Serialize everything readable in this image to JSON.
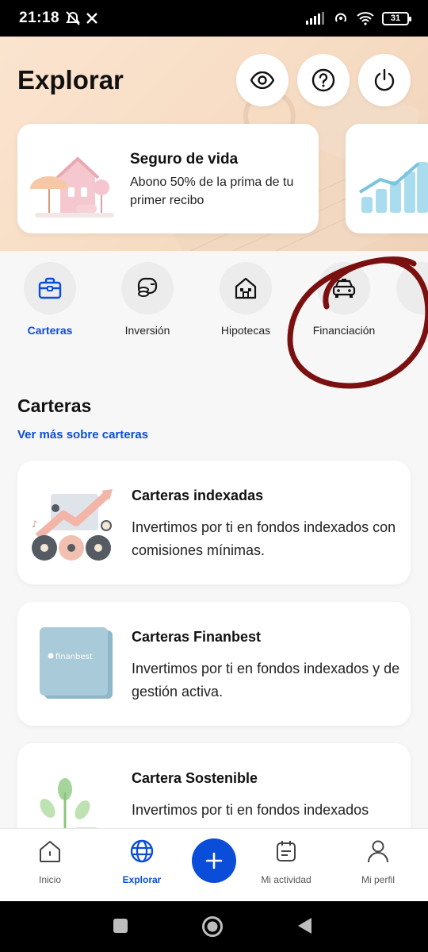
{
  "status_bar": {
    "time": "21:18",
    "battery": "31"
  },
  "header": {
    "title": "Explorar"
  },
  "header_actions": [
    {
      "icon": "eye-icon"
    },
    {
      "icon": "help-icon"
    },
    {
      "icon": "power-icon"
    }
  ],
  "promo": {
    "title": "Seguro de vida",
    "description": "Abono 50% de la prima de tu primer recibo"
  },
  "categories": [
    {
      "label": "Carteras",
      "icon": "briefcase-icon",
      "active": true
    },
    {
      "label": "Inversión",
      "icon": "investment-icon",
      "active": false
    },
    {
      "label": "Hipotecas",
      "icon": "house-icon",
      "active": false
    },
    {
      "label": "Financiación",
      "icon": "car-icon",
      "active": false
    }
  ],
  "section": {
    "title": "Carteras",
    "link": "Ver más sobre carteras"
  },
  "products": [
    {
      "title": "Carteras indexadas",
      "description": "Invertimos por ti en fondos indexados con comisiones mínimas."
    },
    {
      "title": "Carteras Finanbest",
      "description": "Invertimos por ti en fondos indexados y de gestión activa."
    },
    {
      "title": "Cartera Sostenible",
      "description": "Invertimos por ti en fondos indexados"
    }
  ],
  "finanbest_logo": "finanbest",
  "bottom_nav": {
    "items": [
      {
        "label": "Inicio",
        "icon": "home-icon"
      },
      {
        "label": "Explorar",
        "icon": "globe-icon",
        "active": true
      },
      {
        "label": "Mi actividad",
        "icon": "calendar-icon"
      },
      {
        "label": "Mi perfil",
        "icon": "user-icon"
      }
    ],
    "fab_icon": "plus-icon"
  },
  "colors": {
    "accent": "#0a4dd9",
    "hero": "#fbe4cf",
    "annotation": "#7a1010"
  }
}
